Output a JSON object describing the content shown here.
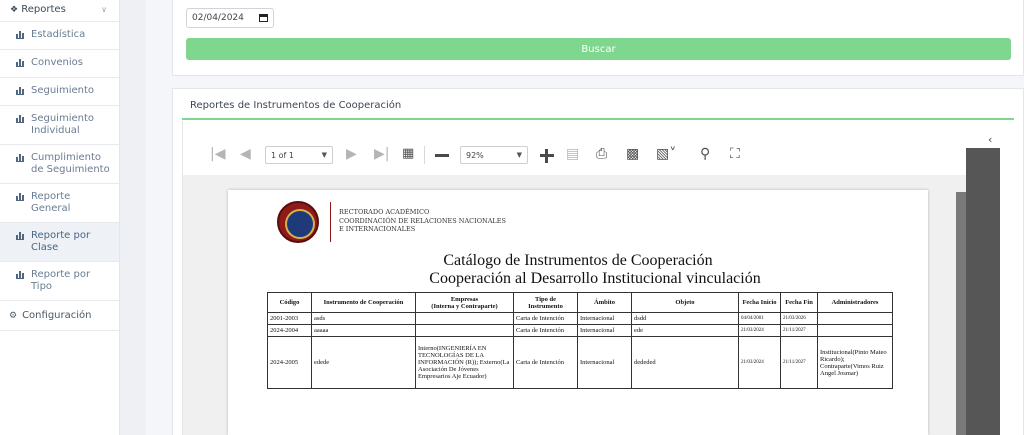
{
  "sidebar": {
    "reportes": "Reportes",
    "items": [
      {
        "label": "Estadística"
      },
      {
        "label": "Convenios"
      },
      {
        "label": "Seguimiento"
      },
      {
        "label": "Seguimiento Individual"
      },
      {
        "label": "Cumplimiento de Seguimiento"
      },
      {
        "label": "Reporte General"
      },
      {
        "label": "Reporte por Clase"
      },
      {
        "label": "Reporte por Tipo"
      }
    ],
    "config": "Configuración"
  },
  "search": {
    "date_value": "02/04/2024",
    "button": "Buscar"
  },
  "report": {
    "title": "Reportes de Instrumentos de Cooperación"
  },
  "viewer": {
    "page_select": "1 of 1",
    "zoom_select": "92%"
  },
  "doc": {
    "org_line1": "RECTORADO ACADÉMICO",
    "org_line2": "COORDINACIÓN DE RELACIONES NACIONALES",
    "org_line3": "E INTERNACIONALES",
    "title1": "Catálogo de Instrumentos de Cooperación",
    "title2": "Cooperación al Desarrollo Institucional vinculación",
    "headers": [
      "Código",
      "Instrumento de Cooperación",
      "Empresas\n(Interna y Contraparte)",
      "Tipo de\nInstrumento",
      "Ámbito",
      "Objeto",
      "Fecha Inicio",
      "Fecha Fin",
      "Administradores"
    ],
    "rows": [
      {
        "codigo": "2001-2003",
        "instrumento": "asds",
        "empresas": "",
        "tipo": "Carta de Intención",
        "ambito": "Internacional",
        "objeto": "dsdd",
        "inicio": "04/04/2001",
        "fin": "21/03/2026",
        "admin": ""
      },
      {
        "codigo": "2024-2004",
        "instrumento": "aaaaa",
        "empresas": "",
        "tipo": "Carta de Intención",
        "ambito": "Internacional",
        "objeto": "ede",
        "inicio": "21/03/2024",
        "fin": "21/11/2027",
        "admin": ""
      },
      {
        "codigo": "2024-2005",
        "instrumento": "edede",
        "empresas": "Interno(INGENIERÍA EN TECNOLOGÍAS DE LA INFORMACIÓN (R)); Externo(La Asociación De Jóvenes Empresarios Aje Ecuador)",
        "tipo": "Carta de Intención",
        "ambito": "Internacional",
        "objeto": "dededed",
        "inicio": "21/03/2024",
        "fin": "21/11/2027",
        "admin": "Institucional(Pinto Mateo Ricardo); Contraparte(Vimos Ruiz Angel Josmar)"
      }
    ]
  }
}
